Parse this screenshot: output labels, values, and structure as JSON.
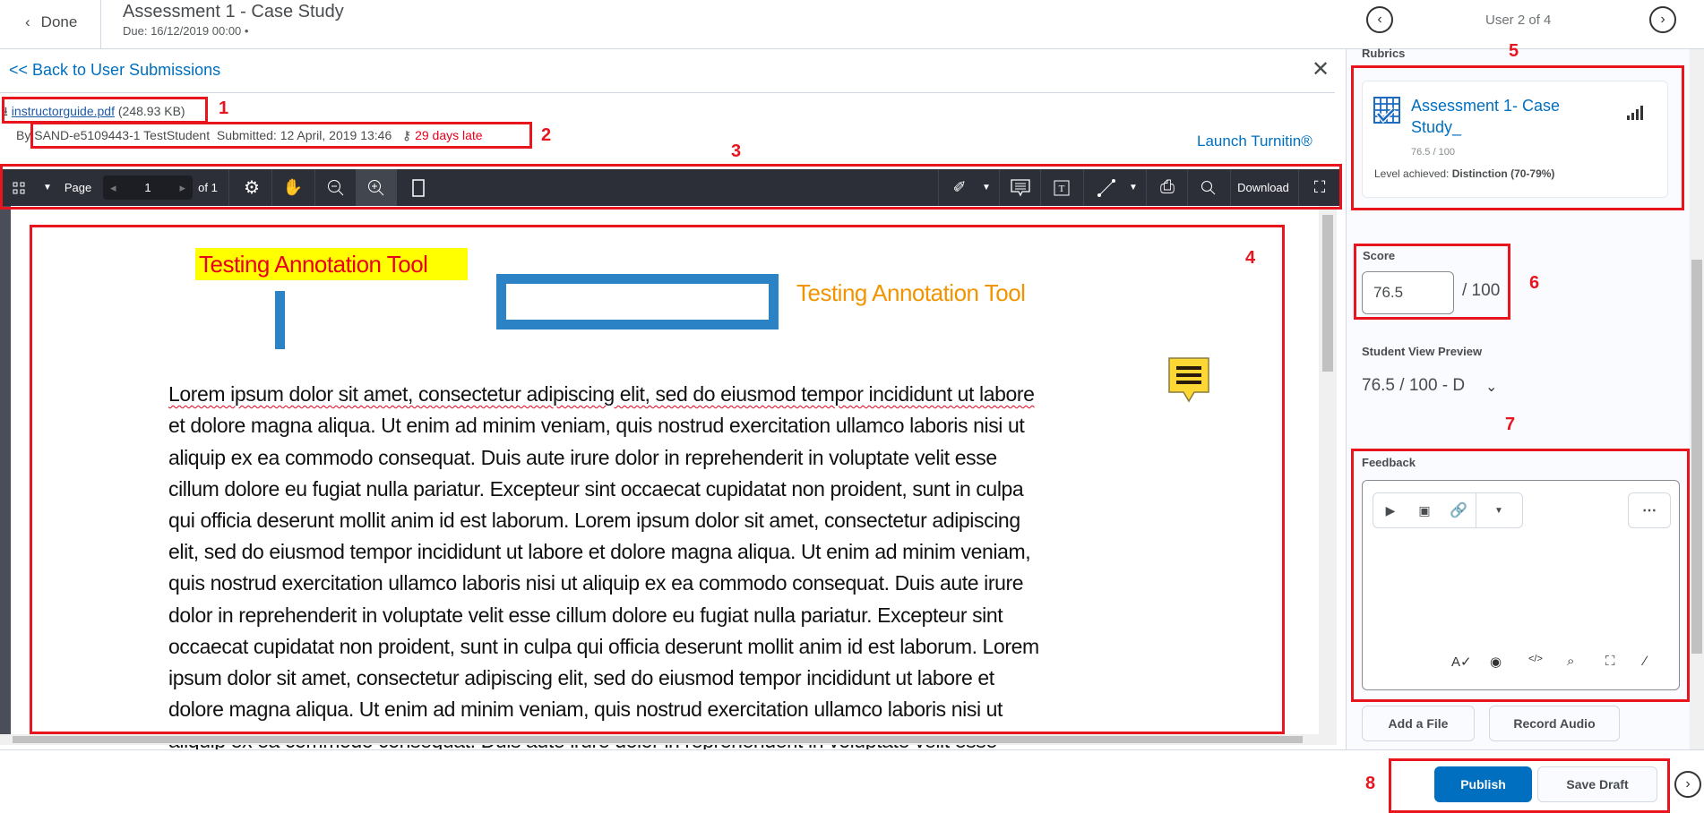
{
  "header": {
    "done_label": "Done",
    "title": "Assessment 1 - Case Study",
    "due": "Due: 16/12/2019 00:00 •"
  },
  "submission": {
    "back_link": "<< Back to User Submissions",
    "file_name": "instructorguide.pdf",
    "file_size": "(248.93 KB)",
    "by_label": "By",
    "student": "SAND-e5109443-1 TestStudent",
    "submitted": "Submitted: 12 April, 2019 13:46",
    "late": "29 days late",
    "launch_turnitin": "Launch Turnitin®"
  },
  "toolbar": {
    "page_label": "Page",
    "page_value": "1",
    "page_of": "of 1",
    "download_label": "Download"
  },
  "document": {
    "highlight_text": "Testing Annotation Tool",
    "orange_text": "Testing Annotation Tool",
    "lines": [
      "Lorem ipsum dolor sit amet, consectetur adipiscing elit, sed do eiusmod tempor incididunt ut labore",
      "et dolore magna aliqua. Ut enim ad minim veniam, quis nostrud exercitation ullamco laboris nisi ut",
      "aliquip ex ea commodo consequat. Duis aute irure dolor in reprehenderit in voluptate velit esse",
      "cillum dolore eu fugiat nulla pariatur. Excepteur sint occaecat cupidatat non proident, sunt in culpa",
      "qui officia deserunt mollit anim id est laborum. Lorem ipsum dolor sit amet, consectetur adipiscing",
      "elit, sed do eiusmod tempor incididunt ut labore et dolore magna aliqua. Ut enim ad minim veniam,",
      "quis nostrud exercitation ullamco laboris nisi ut aliquip ex ea commodo consequat. Duis aute irure",
      "dolor in reprehenderit in voluptate velit esse cillum dolore eu fugiat nulla pariatur. Excepteur sint",
      "occaecat cupidatat non proident, sunt in culpa qui officia deserunt mollit anim id est laborum. Lorem",
      "ipsum dolor sit amet, consectetur adipiscing elit, sed do eiusmod tempor incididunt ut labore et",
      "dolore magna aliqua. Ut enim ad minim veniam, quis nostrud exercitation ullamco laboris nisi ut",
      "aliquip ex ea commodo consequat. Duis aute irure dolor in reprehenderit in voluptate velit esse"
    ]
  },
  "panel": {
    "user_nav": "User 2 of 4",
    "rubrics_label": "Rubrics",
    "rubric": {
      "title": "Assessment 1- Case Study_",
      "score": "76.5 / 100",
      "level_label": "Level achieved:",
      "level": "Distinction (70-79%)"
    },
    "score_label": "Score",
    "score_value": "76.5",
    "score_out_of": "/ 100",
    "preview_label": "Student View Preview",
    "preview_value": "76.5 / 100 - D",
    "feedback_label": "Feedback",
    "add_file": "Add a File",
    "record_audio": "Record Audio"
  },
  "footer": {
    "publish": "Publish",
    "save_draft": "Save Draft"
  },
  "callouts": [
    "1",
    "2",
    "3",
    "4",
    "5",
    "6",
    "7",
    "8"
  ],
  "colors": {
    "accent": "#006fbf",
    "late": "#e8001c",
    "callout": "#e8141e",
    "annotation_blue": "#2b83c6",
    "highlight": "#ffff00"
  }
}
